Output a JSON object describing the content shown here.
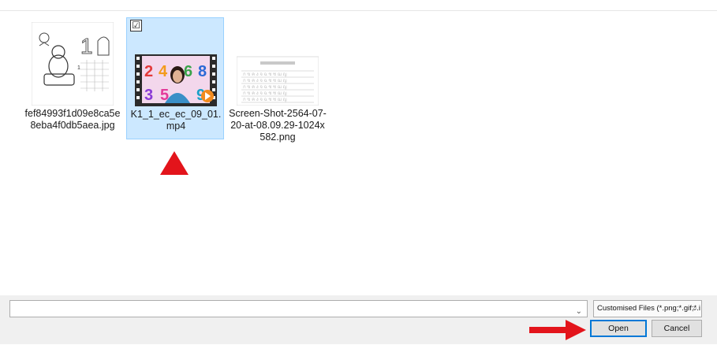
{
  "files": [
    {
      "name": "fef84993f1d09e8ca5e8eba4f0db5aea.jpg",
      "selected": false,
      "thumb": "coloring-worksheet-thumbnail"
    },
    {
      "name": "K1_1_ec_ec_09_01.mp4",
      "selected": true,
      "thumb": "video-thumbnail",
      "checkbox": "☑"
    },
    {
      "name": "Screen-Shot-2564-07-20-at-08.09.29-1024x582.png",
      "selected": false,
      "thumb": "tracing-worksheet-thumbnail"
    }
  ],
  "thumbnail_text": {
    "worksheet_number": "1",
    "video_digits": [
      "2",
      "4",
      "6",
      "8",
      "3",
      "5",
      "9"
    ]
  },
  "bottom_bar": {
    "file_name_value": "",
    "file_type_selected": "Customised Files (*.png;*.gif;*.i",
    "open_label": "Open",
    "cancel_label": "Cancel"
  },
  "colors": {
    "selection_bg": "#cce8ff",
    "selection_border": "#99d1ff",
    "arrow_red": "#e3141b",
    "accent_blue": "#0078d7"
  }
}
